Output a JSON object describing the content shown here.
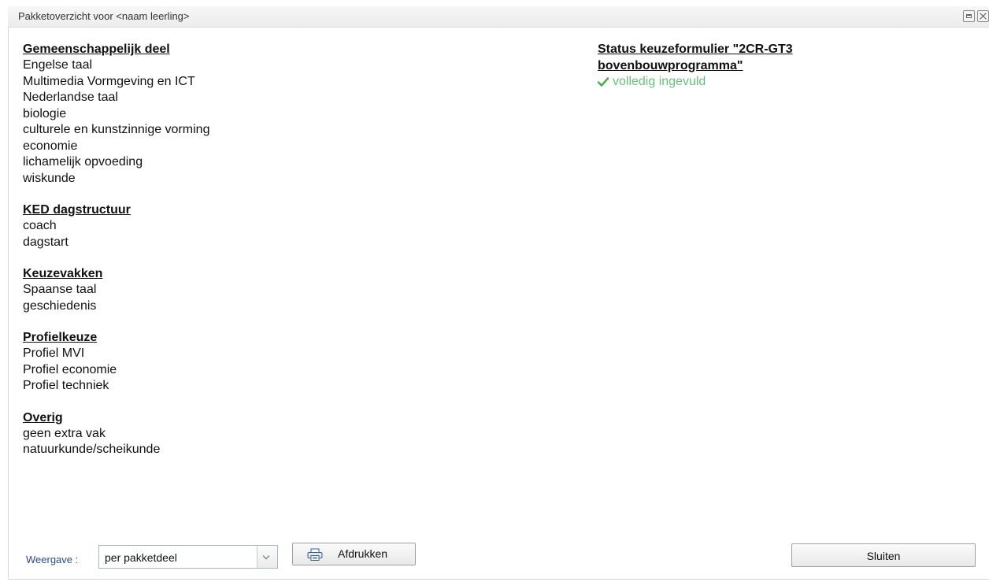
{
  "dialog": {
    "title": "Pakketoverzicht voor <naam leerling>"
  },
  "sections": [
    {
      "heading": "Gemeenschappelijk deel",
      "items": [
        "Engelse taal",
        "Multimedia Vormgeving en ICT",
        "Nederlandse taal",
        "biologie",
        "culturele en kunstzinnige vorming",
        "economie",
        "lichamelijk opvoeding",
        "wiskunde"
      ]
    },
    {
      "heading": "KED dagstructuur",
      "items": [
        "coach",
        "dagstart"
      ]
    },
    {
      "heading": "Keuzevakken",
      "items": [
        "Spaanse taal",
        "geschiedenis"
      ]
    },
    {
      "heading": "Profielkeuze",
      "items": [
        "Profiel MVI",
        "Profiel economie",
        "Profiel techniek"
      ]
    },
    {
      "heading": "Overig",
      "items": [
        "geen extra vak",
        "natuurkunde/scheikunde"
      ]
    }
  ],
  "status": {
    "title_line1": "Status keuzeformulier \"2CR-GT3",
    "title_line2": "bovenbouwprogramma\"",
    "state": "volledig ingevuld",
    "state_color": "#66c17a"
  },
  "footer": {
    "view_label": "Weergave :",
    "view_value": "per pakketdeel",
    "print_label": "Afdrukken",
    "close_label": "Sluiten"
  },
  "icons": {
    "maximize": "maximize-icon",
    "close": "close-icon",
    "check": "check-icon",
    "printer": "printer-icon",
    "dropdown": "chevron-down-icon"
  }
}
